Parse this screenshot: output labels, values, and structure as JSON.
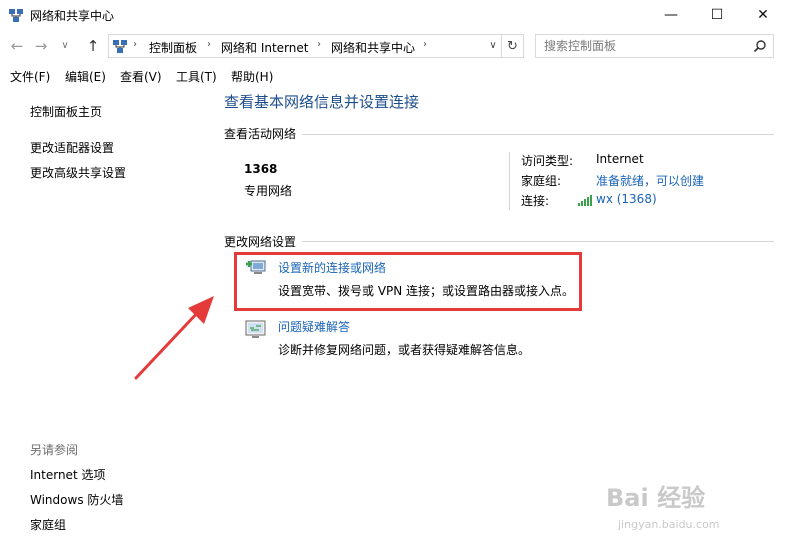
{
  "window": {
    "title": "网络和共享中心",
    "controls": {
      "minimize": "—",
      "maximize": "☐",
      "close": "✕"
    }
  },
  "navigation": {
    "back_icon": "arrow-left-icon",
    "forward_icon": "arrow-right-icon",
    "up_icon": "arrow-up-icon",
    "breadcrumbs": [
      "控制面板",
      "网络和 Internet",
      "网络和共享中心"
    ],
    "refresh_icon": "refresh-icon",
    "search_placeholder": "搜索控制面板"
  },
  "menu": [
    "文件(F)",
    "编辑(E)",
    "查看(V)",
    "工具(T)",
    "帮助(H)"
  ],
  "sidebar": {
    "links": [
      "控制面板主页",
      "更改适配器设置",
      "更改高级共享设置"
    ],
    "see_also_heading": "另请参阅",
    "see_also_links": [
      "Internet 选项",
      "Windows 防火墙",
      "家庭组"
    ]
  },
  "main": {
    "title": "查看基本网络信息并设置连接",
    "active_networks_heading": "查看活动网络",
    "network": {
      "name": "1368",
      "category": "专用网络",
      "access_type_label": "访问类型:",
      "access_type_value": "Internet",
      "homegroup_label": "家庭组:",
      "homegroup_value": "准备就绪，可以创建",
      "connection_label": "连接:",
      "connection_value": "wx (1368)"
    },
    "change_settings_heading": "更改网络设置",
    "tasks": [
      {
        "link": "设置新的连接或网络",
        "description": "设置宽带、拨号或 VPN 连接；或设置路由器或接入点。",
        "icon": "new-connection-icon"
      },
      {
        "link": "问题疑难解答",
        "description": "诊断并修复网络问题，或者获得疑难解答信息。",
        "icon": "troubleshoot-icon"
      }
    ]
  },
  "watermark": {
    "main": "Bai 经验",
    "sub": "jingyan.baidu.com"
  },
  "colors": {
    "link": "#1a64b8",
    "title": "#1e4e8c",
    "highlight": "#e53a3a"
  }
}
